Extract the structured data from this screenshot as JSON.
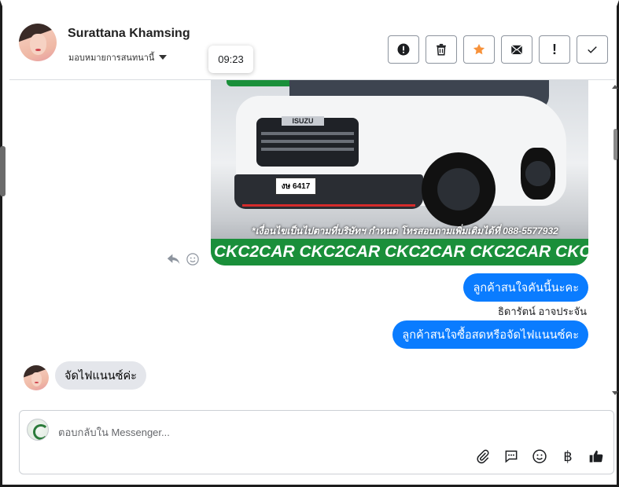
{
  "header": {
    "contact_name": "Surattana Khamsing",
    "assign_label": "มอบหมายการสนทนานี้",
    "time_tooltip": "09:23",
    "actions": [
      {
        "icon": "alert-circle-icon"
      },
      {
        "icon": "trash-icon"
      },
      {
        "icon": "star-icon",
        "color": "#f7923b"
      },
      {
        "icon": "mail-icon"
      },
      {
        "icon": "exclamation-icon",
        "label": "!"
      },
      {
        "icon": "check-icon"
      }
    ]
  },
  "conversation": {
    "image": {
      "plate_text": "งษ 6417",
      "brand_badge": "ISUZU",
      "caption": "*เงื่อนไขเป็นไปตามที่บริษัทฯ กำหนด โทรสอบถามเพิ่มเติมได้ที่ 088-5577932",
      "banner": "CKC2CAR CKC2CAR CKC2CAR CKC2CAR CKC2CAR CKC2"
    },
    "outgoing": [
      {
        "text": "ลูกค้าสนใจคันนี้นะคะ"
      },
      {
        "text": "ลูกค้าสนใจซื้อสดหรือจัดไฟแนนซ์คะ"
      }
    ],
    "sender_label": "ธิดารัตน์ อาจประจัน",
    "incoming": [
      {
        "text": "จัดไฟแนนซ์ค่ะ"
      }
    ]
  },
  "composer": {
    "placeholder": "ตอบกลับใน Messenger...",
    "tools": [
      "paperclip-icon",
      "saved-reply-icon",
      "emoji-icon",
      "baht-icon",
      "thumbs-up-icon"
    ],
    "baht_symbol": "฿"
  },
  "colors": {
    "accent_blue": "#0a7cff",
    "incoming_bubble": "#e4e6eb",
    "star": "#f7923b",
    "banner_green": "#1a8f3a"
  }
}
